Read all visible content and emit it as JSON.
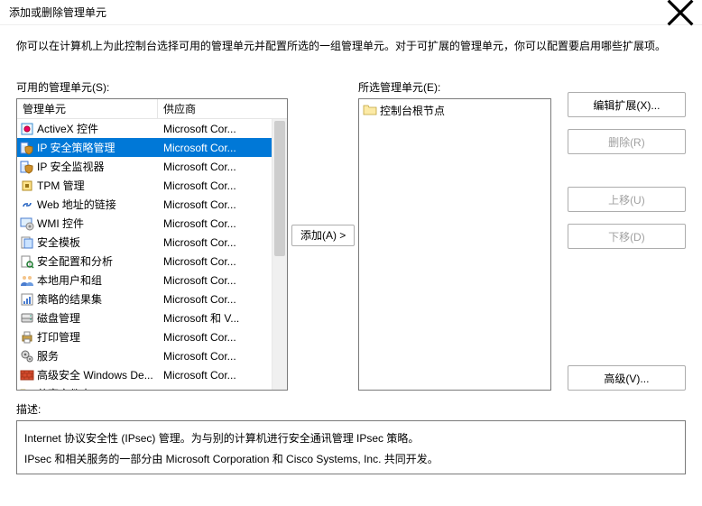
{
  "title": "添加或删除管理单元",
  "instruction": "你可以在计算机上为此控制台选择可用的管理单元并配置所选的一组管理单元。对于可扩展的管理单元，你可以配置要启用哪些扩展项。",
  "available_label": "可用的管理单元(S):",
  "selected_label": "所选管理单元(E):",
  "add_button": "添加(A) >",
  "edit_ext_button": "编辑扩展(X)...",
  "remove_button": "删除(R)",
  "move_up_button": "上移(U)",
  "move_down_button": "下移(D)",
  "advanced_button": "高级(V)...",
  "desc_label": "描述:",
  "desc_text": "Internet 协议安全性 (IPsec) 管理。为与别的计算机进行安全通讯管理 IPsec 策略。",
  "desc_text2": "IPsec 和相关服务的一部分由 Microsoft Corporation 和 Cisco Systems, Inc. 共同开发。",
  "columns": {
    "name": "管理单元",
    "vendor": "供应商"
  },
  "root_node": "控制台根节点",
  "snapins": [
    {
      "name": "ActiveX 控件",
      "vendor": "Microsoft Cor...",
      "icon": "activex"
    },
    {
      "name": "IP 安全策略管理",
      "vendor": "Microsoft Cor...",
      "icon": "shield-server",
      "selected": true
    },
    {
      "name": "IP 安全监视器",
      "vendor": "Microsoft Cor...",
      "icon": "shield-server"
    },
    {
      "name": "TPM 管理",
      "vendor": "Microsoft Cor...",
      "icon": "chip"
    },
    {
      "name": "Web 地址的链接",
      "vendor": "Microsoft Cor...",
      "icon": "link"
    },
    {
      "name": "WMI 控件",
      "vendor": "Microsoft Cor...",
      "icon": "gear-monitor"
    },
    {
      "name": "安全模板",
      "vendor": "Microsoft Cor...",
      "icon": "template"
    },
    {
      "name": "安全配置和分析",
      "vendor": "Microsoft Cor...",
      "icon": "analyze"
    },
    {
      "name": "本地用户和组",
      "vendor": "Microsoft Cor...",
      "icon": "users"
    },
    {
      "name": "策略的结果集",
      "vendor": "Microsoft Cor...",
      "icon": "results"
    },
    {
      "name": "磁盘管理",
      "vendor": "Microsoft 和 V...",
      "icon": "disk"
    },
    {
      "name": "打印管理",
      "vendor": "Microsoft Cor...",
      "icon": "printer"
    },
    {
      "name": "服务",
      "vendor": "Microsoft Cor...",
      "icon": "gears"
    },
    {
      "name": "高级安全 Windows De...",
      "vendor": "Microsoft Cor...",
      "icon": "firewall"
    },
    {
      "name": "共享文件夹",
      "vendor": "Microsoft Cor...",
      "icon": "folder-share"
    }
  ]
}
